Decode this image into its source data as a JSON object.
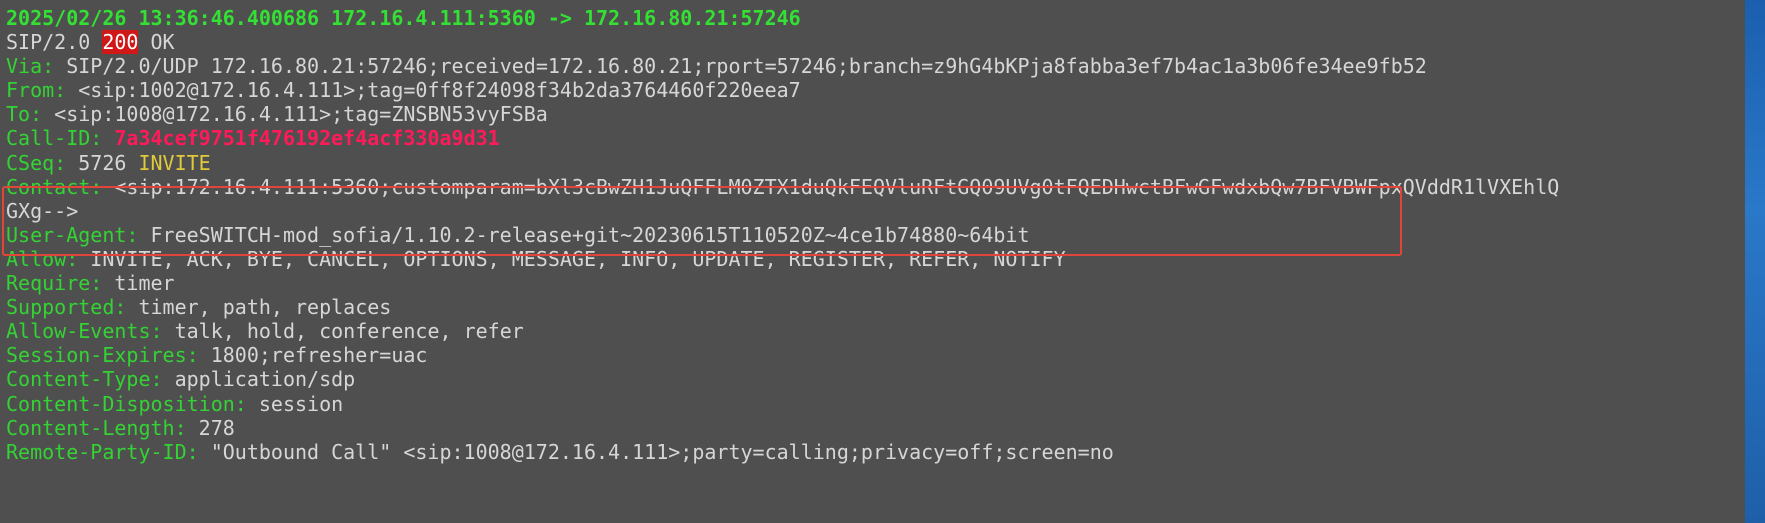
{
  "terminal": {
    "first_line": "2025/02/26 13:36:46.400686 172.16.4.111:5360 -> 172.16.80.21:57246",
    "status": {
      "proto": "SIP/2.0 ",
      "code": "200",
      "reason": " OK"
    },
    "via": {
      "name": "Via:",
      "value": " SIP/2.0/UDP 172.16.80.21:57246;received=172.16.80.21;rport=57246;branch=z9hG4bKPja8fabba3ef7b4ac1a3b06fe34ee9fb52"
    },
    "from": {
      "name": "From:",
      "value": " <sip:1002@172.16.4.111>;tag=0ff8f24098f34b2da3764460f220eea7"
    },
    "to": {
      "name": "To:",
      "value": " <sip:1008@172.16.4.111>;tag=ZNSBN53vyFSBa"
    },
    "callid": {
      "name": "Call-ID:",
      "value": "7a34cef9751f476192ef4acf330a9d31"
    },
    "cseq": {
      "name": "CSeq:",
      "value": " 5726 ",
      "method": "INVITE"
    },
    "contact": {
      "name": "Contact:",
      "value": " <sip:172.16.4.111:5360;customparam=bXl3cBwZH1JuQFFLM0ZTX1duQkFEQVluRFtGQ09UVg0tFQEDHwctBFwGFwdxbQw7BFVBWFpxQVddR1lVXEhlQ",
      "cont": "GXg-->"
    },
    "user_agent": {
      "name": "User-Agent:",
      "value": " FreeSWITCH-mod_sofia/1.10.2-release+git~20230615T110520Z~4ce1b74880~64bit"
    },
    "allow": {
      "name": "Allow:",
      "value": " INVITE, ACK, BYE, CANCEL, OPTIONS, MESSAGE, INFO, UPDATE, REGISTER, REFER, NOTIFY"
    },
    "require": {
      "name": "Require:",
      "value": " timer"
    },
    "supported": {
      "name": "Supported:",
      "value": " timer, path, replaces"
    },
    "allow_events": {
      "name": "Allow-Events:",
      "value": " talk, hold, conference, refer"
    },
    "session_expires": {
      "name": "Session-Expires:",
      "value": " 1800;refresher=uac"
    },
    "content_type": {
      "name": "Content-Type:",
      "value": " application/sdp"
    },
    "content_disposition": {
      "name": "Content-Disposition:",
      "value": " session"
    },
    "content_length": {
      "name": "Content-Length:",
      "value": " 278"
    },
    "remote_party_id": {
      "name": "Remote-Party-ID:",
      "value": " \"Outbound Call\" <sip:1008@172.16.4.111>;party=calling;privacy=off;screen=no"
    }
  },
  "colors": {
    "background": "#4f4f4f",
    "header_name": "#34d334",
    "value_text": "#d6d6d6",
    "status_code_bg": "#d01818",
    "call_id": "#ff1a5a",
    "method": "#e0c93a",
    "annotation_box": "#e1453a"
  }
}
